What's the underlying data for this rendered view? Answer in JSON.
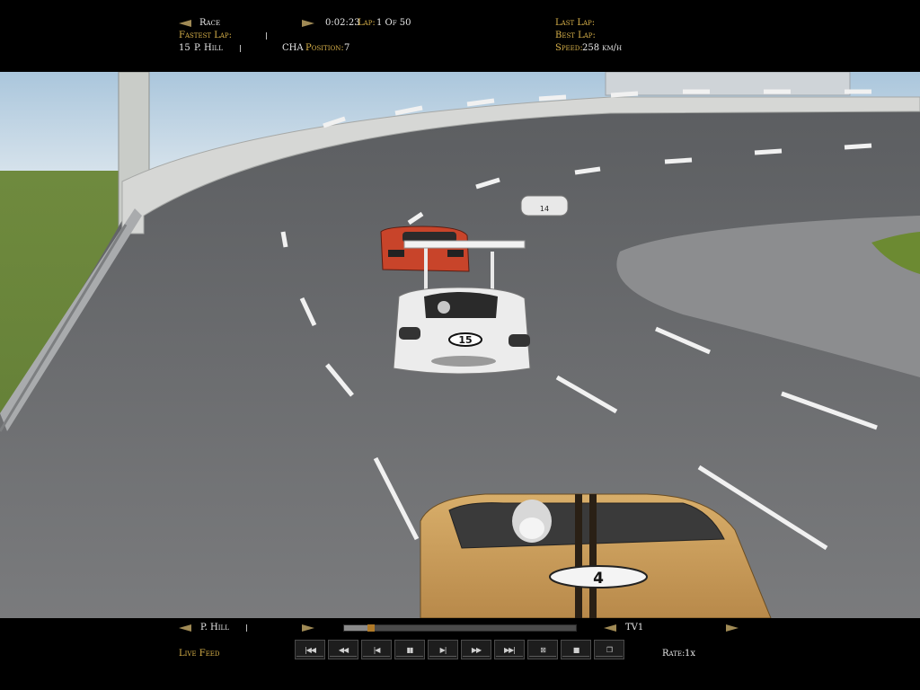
{
  "top_hud": {
    "session_label": "Race",
    "time": "0:02:23",
    "lap_label": "Lap:",
    "lap_value": "1 Of 50",
    "fastest_lap_label": "Fastest Lap:",
    "driver_number": "15",
    "driver_name": "P. Hill",
    "team": "CHA",
    "position_label": "Position:",
    "position_value": "7",
    "last_lap_label": "Last Lap:",
    "best_lap_label": "Best Lap:",
    "speed_label": "Speed:",
    "speed_value": "258 km/h"
  },
  "bottom_hud": {
    "driver_name": "P. Hill",
    "camera": "TV1",
    "live_feed": "Live Feed",
    "rate_label": "Rate:",
    "rate_value": "1x",
    "progress": 0.11,
    "controls": [
      {
        "name": "skip-to-start-button",
        "glyph": "|◀◀"
      },
      {
        "name": "rewind-button",
        "glyph": "◀◀"
      },
      {
        "name": "step-back-button",
        "glyph": "|◀"
      },
      {
        "name": "pause-button",
        "glyph": "▮▮"
      },
      {
        "name": "step-forward-button",
        "glyph": "▶|"
      },
      {
        "name": "fast-forward-button",
        "glyph": "▶▶"
      },
      {
        "name": "skip-to-end-button",
        "glyph": "▶▶|"
      },
      {
        "name": "toggle-view-button",
        "glyph": "⊠"
      },
      {
        "name": "stop-button",
        "glyph": "■"
      },
      {
        "name": "copy-button",
        "glyph": "❐"
      }
    ]
  },
  "cars": {
    "front_car_number": "15",
    "player_car_number": "4",
    "distant_car_number": "14"
  },
  "colors": {
    "hud_gold": "#d9b24a",
    "track": "#6e6f71",
    "player_car": "#c79a55",
    "rival_red": "#c8442a"
  }
}
